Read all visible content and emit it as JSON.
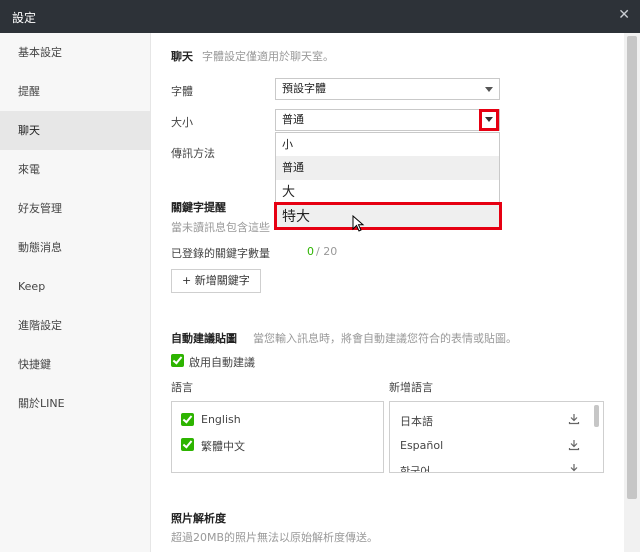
{
  "window": {
    "title": "設定",
    "close_icon": "close-icon"
  },
  "sidebar": {
    "items": [
      {
        "label": "基本設定"
      },
      {
        "label": "提醒"
      },
      {
        "label": "聊天",
        "active": true
      },
      {
        "label": "來電"
      },
      {
        "label": "好友管理"
      },
      {
        "label": "動態消息"
      },
      {
        "label": "Keep"
      },
      {
        "label": "進階設定"
      },
      {
        "label": "快捷鍵"
      },
      {
        "label": "關於LINE"
      }
    ]
  },
  "chat": {
    "title": "聊天",
    "subtitle": "字體設定僅適用於聊天室。",
    "font_label": "字體",
    "font_value": "預設字體",
    "size_label": "大小",
    "size_value": "普通",
    "send_label": "傳訊方法",
    "size_options": [
      {
        "label": "小"
      },
      {
        "label": "普通"
      },
      {
        "label": "大"
      },
      {
        "label": "特大"
      }
    ]
  },
  "keywords": {
    "title": "關鍵字提醒",
    "desc": "當未讀訊息包含這些",
    "count_label": "已登錄的關鍵字數量",
    "count_value": "0",
    "count_max": "/ 20",
    "add_button": "+ 新增關鍵字"
  },
  "auto_suggest": {
    "title": "自動建議貼圖",
    "desc": "當您輸入訊息時，將會自動建議您符合的表情或貼圖。",
    "enable_label": "啟用自動建議",
    "enabled": true,
    "lang_header": "語言",
    "add_lang_header": "新增語言",
    "languages": [
      {
        "label": "English",
        "checked": true
      },
      {
        "label": "繁體中文",
        "checked": true
      }
    ],
    "available": [
      {
        "label": "日本語"
      },
      {
        "label": "Español"
      },
      {
        "label": "한국어"
      }
    ]
  },
  "photo": {
    "title": "照片解析度",
    "desc": "超過20MB的照片無法以原始解析度傳送。"
  },
  "colors": {
    "accent_green": "#2db400",
    "highlight_red": "#e60012",
    "titlebar": "#2d3238"
  }
}
